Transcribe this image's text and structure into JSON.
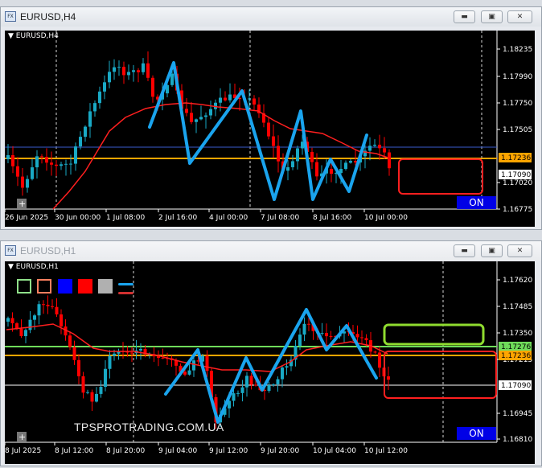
{
  "windows": [
    {
      "id": "h4",
      "title": "EURUSD,H4",
      "symbol_label": "EURUSD,H4",
      "on_label": "ON",
      "buttons": [
        "minimize",
        "restore",
        "close"
      ],
      "price_ticks": [
        "1.18235",
        "1.17990",
        "1.17750",
        "1.17505",
        "1.17020",
        "1.16775"
      ],
      "price_labels": [
        {
          "text": "1.17236",
          "style": "orange"
        },
        {
          "text": "1.17090",
          "style": "white"
        }
      ],
      "time_ticks": [
        "26 Jun 2025",
        "30 Jun 00:00",
        "1 Jul 08:00",
        "2 Jul 16:00",
        "4 Jul 00:00",
        "7 Jul 08:00",
        "8 Jul 16:00",
        "10 Jul 00:00"
      ]
    },
    {
      "id": "h1",
      "title": "EURUSD,H1",
      "symbol_label": "EURUSD,H1",
      "on_label": "ON",
      "watermark": "TPSPROTRADING.COM.UA",
      "buttons": [
        "minimize",
        "restore",
        "close"
      ],
      "price_ticks": [
        "1.17620",
        "1.17485",
        "1.17350",
        "1.17215",
        "1.16945",
        "1.16810"
      ],
      "price_labels": [
        {
          "text": "1.17276",
          "style": "green"
        },
        {
          "text": "1.17236",
          "style": "orange"
        },
        {
          "text": "1.17090",
          "style": "white"
        }
      ],
      "time_ticks": [
        "8 Jul 2025",
        "8 Jul 12:00",
        "8 Jul 20:00",
        "9 Jul 04:00",
        "9 Jul 12:00",
        "9 Jul 20:00",
        "10 Jul 04:00",
        "10 Jul 12:00"
      ],
      "tool_swatches": [
        "green-rect",
        "salmon-rect",
        "blue",
        "red",
        "gray",
        "line-blue",
        "line-red"
      ]
    }
  ],
  "colors": {
    "bull": "#19a9c5",
    "bear": "#ff0000",
    "ma": "#ff1f1f",
    "trendline": "#1aa4ee",
    "orange_level": "#ffa500",
    "green_level": "#6fdc5a",
    "on_button": "#0000e6"
  }
}
